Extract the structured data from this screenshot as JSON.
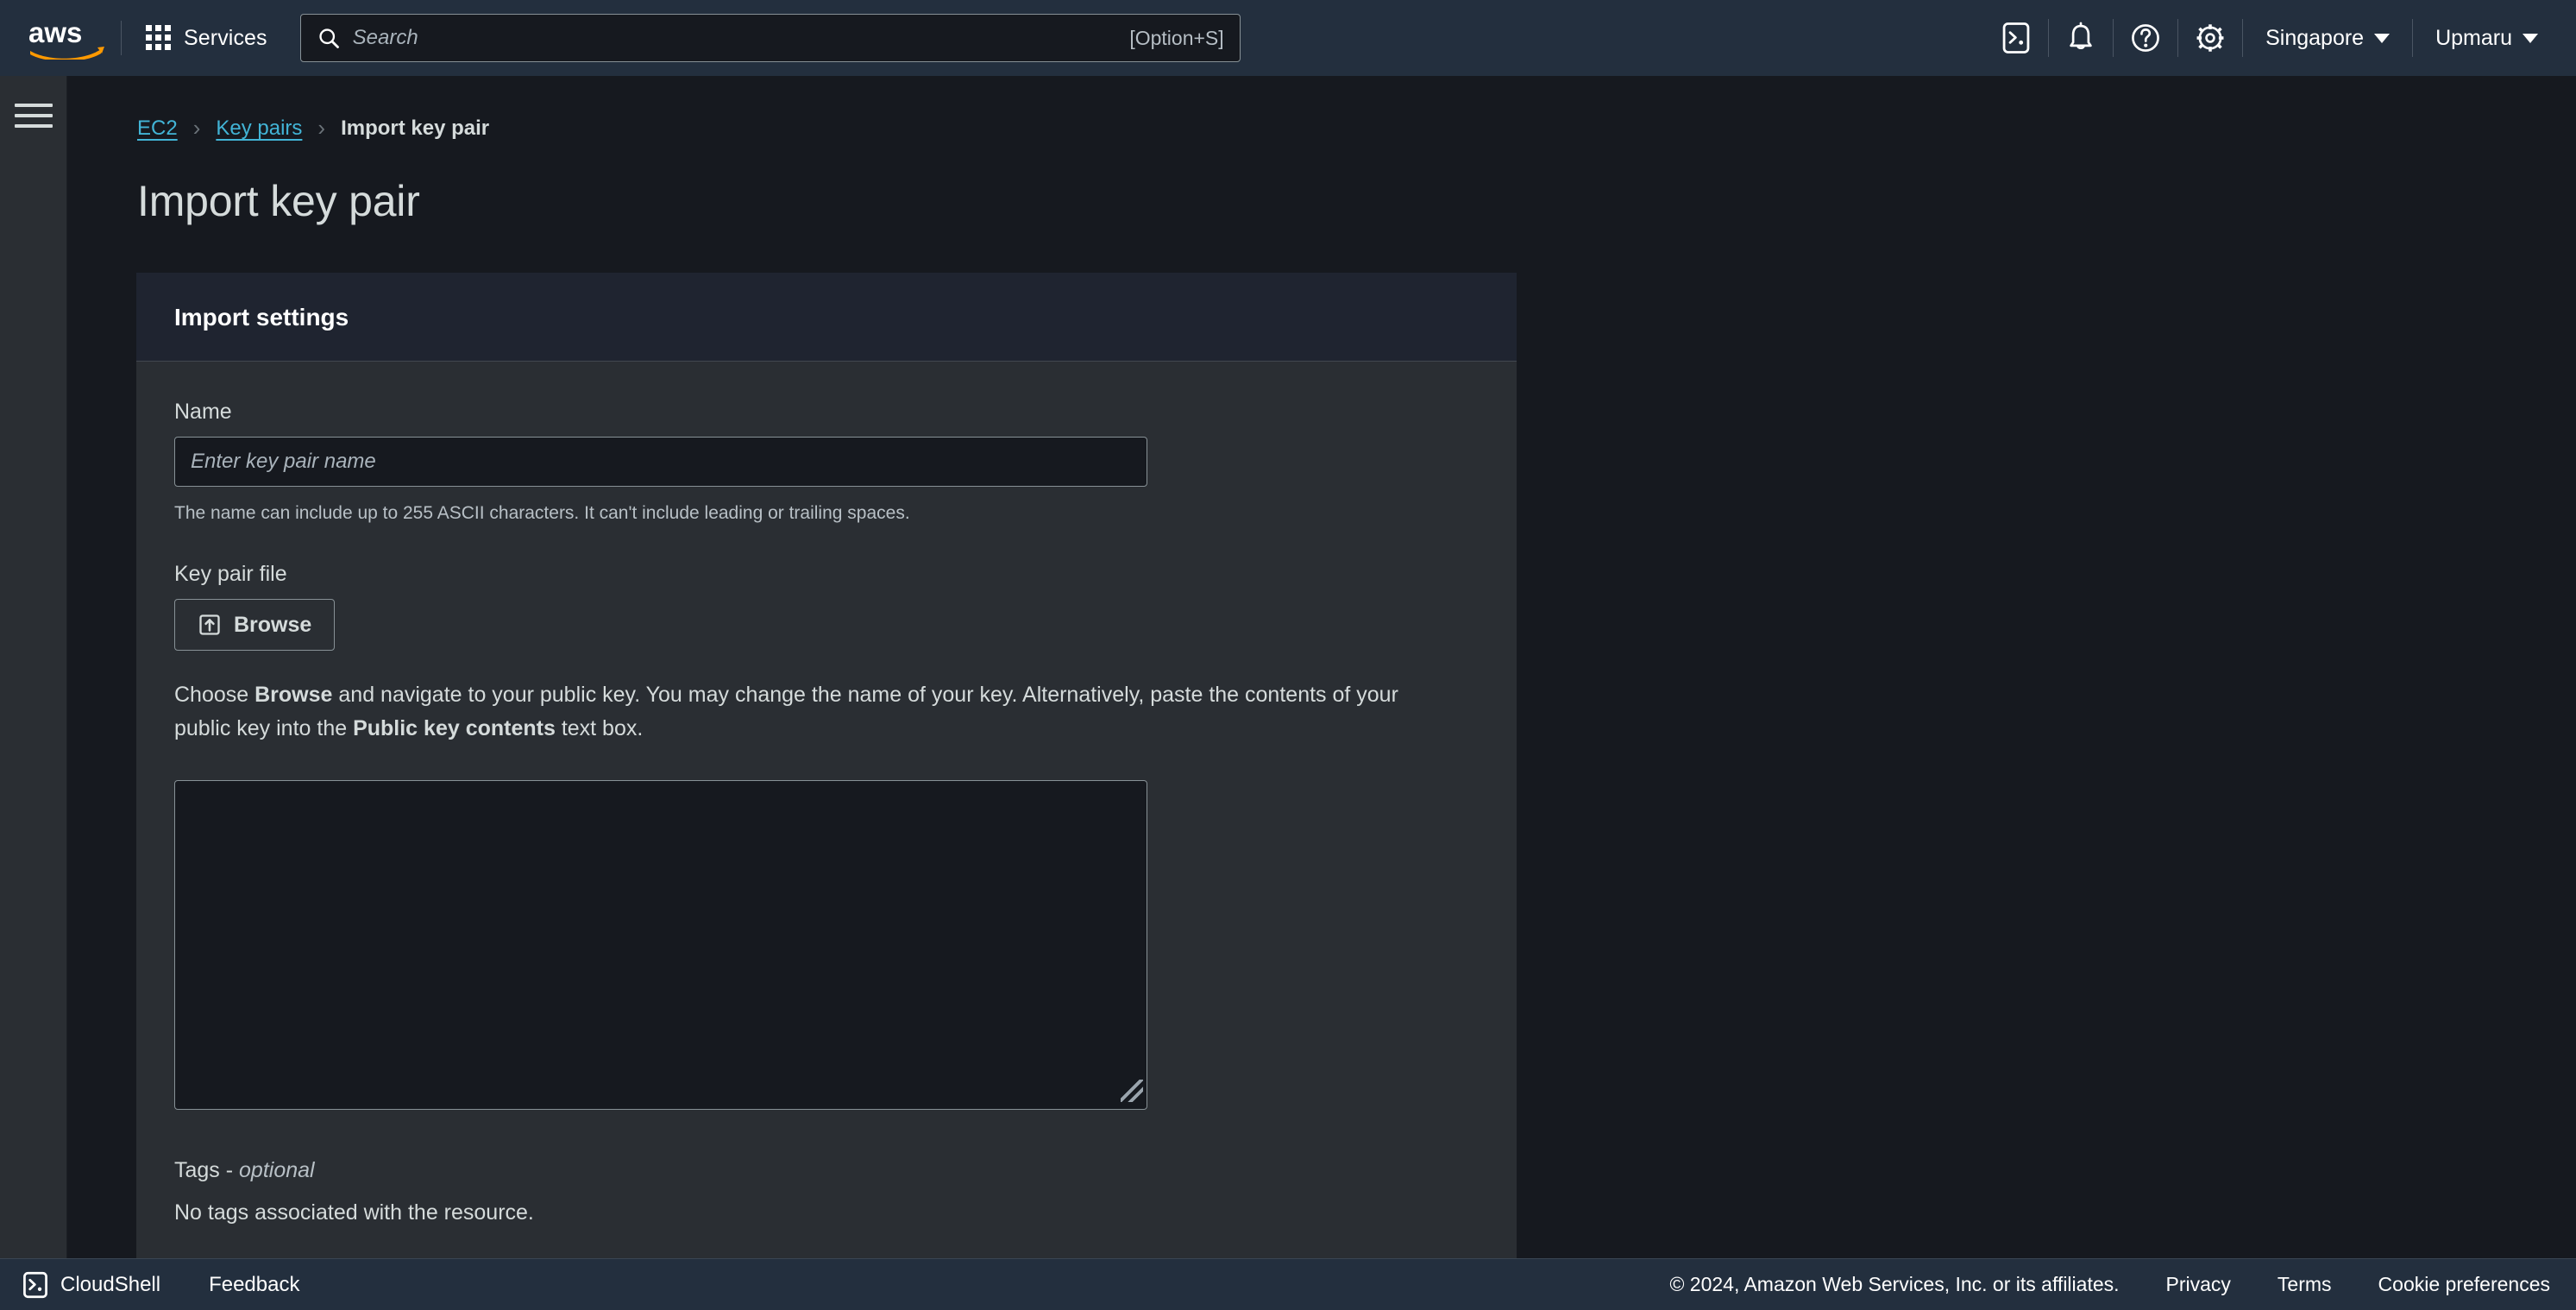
{
  "top_nav": {
    "logo_alt": "aws",
    "services_label": "Services",
    "search": {
      "placeholder": "Search",
      "shortcut": "[Option+S]",
      "icon": "search-icon"
    },
    "icons": [
      {
        "name": "cloudshell-icon",
        "title": "CloudShell"
      },
      {
        "name": "bell-icon",
        "title": "Notifications"
      },
      {
        "name": "question-circle-icon",
        "title": "Help"
      },
      {
        "name": "gear-icon",
        "title": "Settings"
      }
    ],
    "region_label": "Singapore",
    "account_label": "Upmaru"
  },
  "sidebar": {
    "toggle_name": "hamburger-menu-icon"
  },
  "breadcrumb": {
    "items": [
      {
        "label": "EC2",
        "link": true
      },
      {
        "label": "Key pairs",
        "link": true
      },
      {
        "label": "Import key pair",
        "link": false
      }
    ],
    "separator": "›"
  },
  "page": {
    "title": "Import key pair"
  },
  "card": {
    "header_title": "Import settings",
    "name_field": {
      "label": "Name",
      "value": "",
      "placeholder": "Enter key pair name",
      "helper": "The name can include up to 255 ASCII characters. It can't include leading or trailing spaces."
    },
    "key_pair_file": {
      "label": "Key pair file",
      "browse_label": "Browse",
      "browse_icon": "upload-icon",
      "help_prefix": "Choose ",
      "help_bold_1": "Browse",
      "help_middle": " and navigate to your public key. You may change the name of your key. Alternatively, paste the contents of your public key into the ",
      "help_bold_2": "Public key contents",
      "help_suffix": " text box."
    },
    "public_key_contents": {
      "value": "",
      "placeholder": ""
    },
    "tags": {
      "label_main": "Tags - ",
      "label_optional": "optional",
      "empty_text": "No tags associated with the resource."
    }
  },
  "footer": {
    "cloudshell_label": "CloudShell",
    "cloudshell_icon": "cloudshell-icon",
    "feedback_label": "Feedback",
    "copyright": "© 2024, Amazon Web Services, Inc. or its affiliates.",
    "links": [
      {
        "label": "Privacy"
      },
      {
        "label": "Terms"
      },
      {
        "label": "Cookie preferences"
      }
    ]
  },
  "colors": {
    "nav_bg": "#232f3e",
    "page_bg": "#16191f",
    "card_bg": "#2a2e33",
    "card_header_bg": "#1f2430",
    "link": "#42b4d6",
    "text": "#d5dbdb",
    "logo_orange": "#ff9900"
  }
}
